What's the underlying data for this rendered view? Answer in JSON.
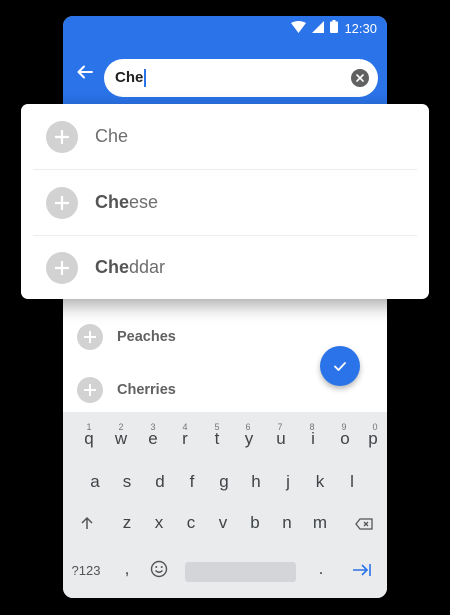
{
  "status_bar": {
    "time": "12:30"
  },
  "search": {
    "value": "Che"
  },
  "suggestions": [
    {
      "match": "Che",
      "rest": ""
    },
    {
      "match": "Che",
      "rest": "ese"
    },
    {
      "match": "Che",
      "rest": "ddar"
    }
  ],
  "list_items": [
    {
      "label": "Peaches"
    },
    {
      "label": "Cherries"
    }
  ],
  "keyboard": {
    "row1": [
      "q",
      "w",
      "e",
      "r",
      "t",
      "y",
      "u",
      "i",
      "o",
      "p"
    ],
    "row1_hints": [
      "1",
      "2",
      "3",
      "4",
      "5",
      "6",
      "7",
      "8",
      "9",
      "0"
    ],
    "row2": [
      "a",
      "s",
      "d",
      "f",
      "g",
      "h",
      "j",
      "k",
      "l"
    ],
    "row3": [
      "z",
      "x",
      "c",
      "v",
      "b",
      "n",
      "m"
    ],
    "symbols_label": "?123",
    "comma": ",",
    "period": "."
  },
  "colors": {
    "accent": "#2a73e8",
    "keyboard_bg": "#e9ebed",
    "plus_circle": "#d2d2d2"
  },
  "icons": {
    "back": "arrow-left-icon",
    "clear": "clear-circle-icon",
    "add": "plus-icon",
    "confirm": "checkmark-icon",
    "shift": "shift-arrow-icon",
    "backspace": "backspace-icon",
    "emoji": "emoji-icon",
    "enter": "tab-next-icon"
  }
}
